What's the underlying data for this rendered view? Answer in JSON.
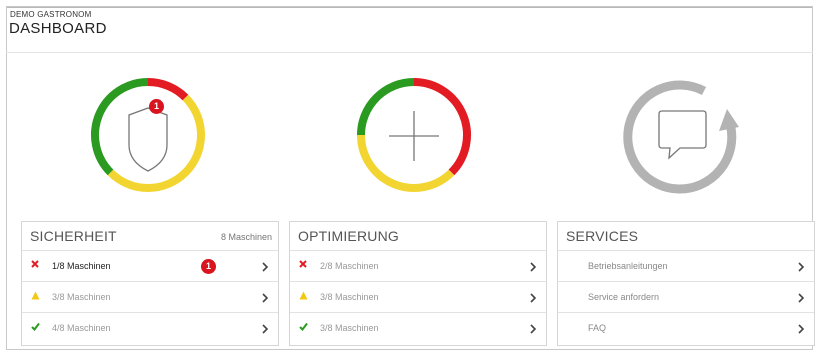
{
  "header": {
    "company": "DEMO GASTRONOM",
    "title": "DASHBOARD"
  },
  "colors": {
    "green": "#2b9a20",
    "yellow": "#f2d531",
    "red": "#e31b23",
    "gray": "#b3b3b3",
    "badge": "#d9141f"
  },
  "gauges": {
    "sicherheit": {
      "icon": "shield-icon",
      "badge": "1",
      "segments": {
        "green": 0.375,
        "yellow": 0.5,
        "red": 0.125
      }
    },
    "optimierung": {
      "icon": "plus-icon",
      "segments": {
        "green": 0.25,
        "yellow": 0.375,
        "red": 0.375
      }
    },
    "services": {
      "icon": "chat-bubble-icon"
    }
  },
  "panels": {
    "sicherheit": {
      "title": "SICHERHEIT",
      "count": "8 Maschinen",
      "rows": [
        {
          "status": "error",
          "label": "1/8 Maschinen",
          "badge": "1"
        },
        {
          "status": "warning",
          "label": "3/8 Maschinen"
        },
        {
          "status": "ok",
          "label": "4/8 Maschinen"
        }
      ]
    },
    "optimierung": {
      "title": "OPTIMIERUNG",
      "rows": [
        {
          "status": "error",
          "label": "2/8 Maschinen"
        },
        {
          "status": "warning",
          "label": "3/8 Maschinen"
        },
        {
          "status": "ok",
          "label": "3/8 Maschinen"
        }
      ]
    },
    "services": {
      "title": "SERVICES",
      "rows": [
        {
          "label": "Betriebsanleitungen"
        },
        {
          "label": "Service anfordern"
        },
        {
          "label": "FAQ"
        }
      ]
    }
  }
}
